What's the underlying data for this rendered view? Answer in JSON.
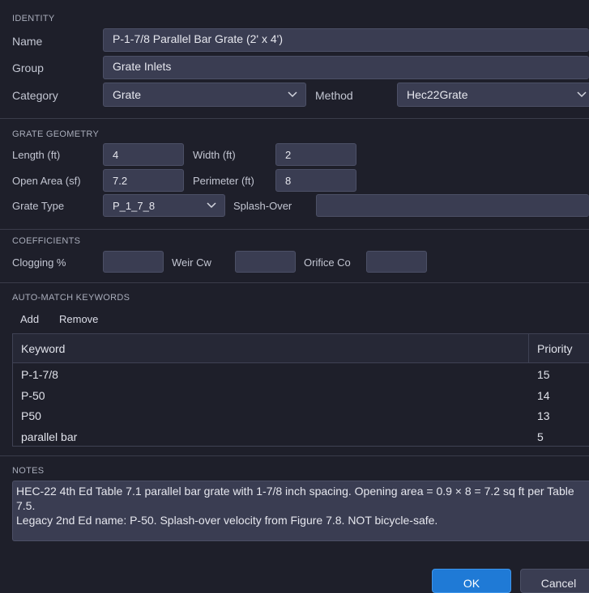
{
  "identity": {
    "section_title": "IDENTITY",
    "name_label": "Name",
    "name_value": "P-1-7/8 Parallel Bar Grate (2' x 4')",
    "group_label": "Group",
    "group_value": "Grate Inlets",
    "category_label": "Category",
    "category_value": "Grate",
    "method_label": "Method",
    "method_value": "Hec22Grate"
  },
  "geometry": {
    "section_title": "GRATE GEOMETRY",
    "length_label": "Length (ft)",
    "length_value": "4",
    "width_label": "Width (ft)",
    "width_value": "2",
    "open_area_label": "Open Area (sf)",
    "open_area_value": "7.2",
    "perimeter_label": "Perimeter (ft)",
    "perimeter_value": "8",
    "grate_type_label": "Grate Type",
    "grate_type_value": "P_1_7_8",
    "splash_over_label": "Splash-Over",
    "splash_over_value": ""
  },
  "coefficients": {
    "section_title": "COEFFICIENTS",
    "clogging_label": "Clogging %",
    "clogging_value": "",
    "weir_label": "Weir Cw",
    "weir_value": "",
    "orifice_label": "Orifice Co",
    "orifice_value": ""
  },
  "keywords": {
    "section_title": "AUTO-MATCH KEYWORDS",
    "add_label": "Add",
    "remove_label": "Remove",
    "columns": [
      "Keyword",
      "Priority"
    ],
    "rows": [
      {
        "keyword": "P-1-7/8",
        "priority": "15"
      },
      {
        "keyword": "P-50",
        "priority": "14"
      },
      {
        "keyword": "P50",
        "priority": "13"
      },
      {
        "keyword": "parallel bar",
        "priority": "5"
      }
    ]
  },
  "notes": {
    "section_title": "NOTES",
    "text": "HEC-22 4th Ed Table 7.1 parallel bar grate with 1-7/8 inch spacing. Opening area = 0.9 × 8 = 7.2 sq ft per Table 7.5.\nLegacy 2nd Ed name: P-50. Splash-over velocity from Figure 7.8. NOT bicycle-safe."
  },
  "footer": {
    "ok_label": "OK",
    "cancel_label": "Cancel"
  }
}
